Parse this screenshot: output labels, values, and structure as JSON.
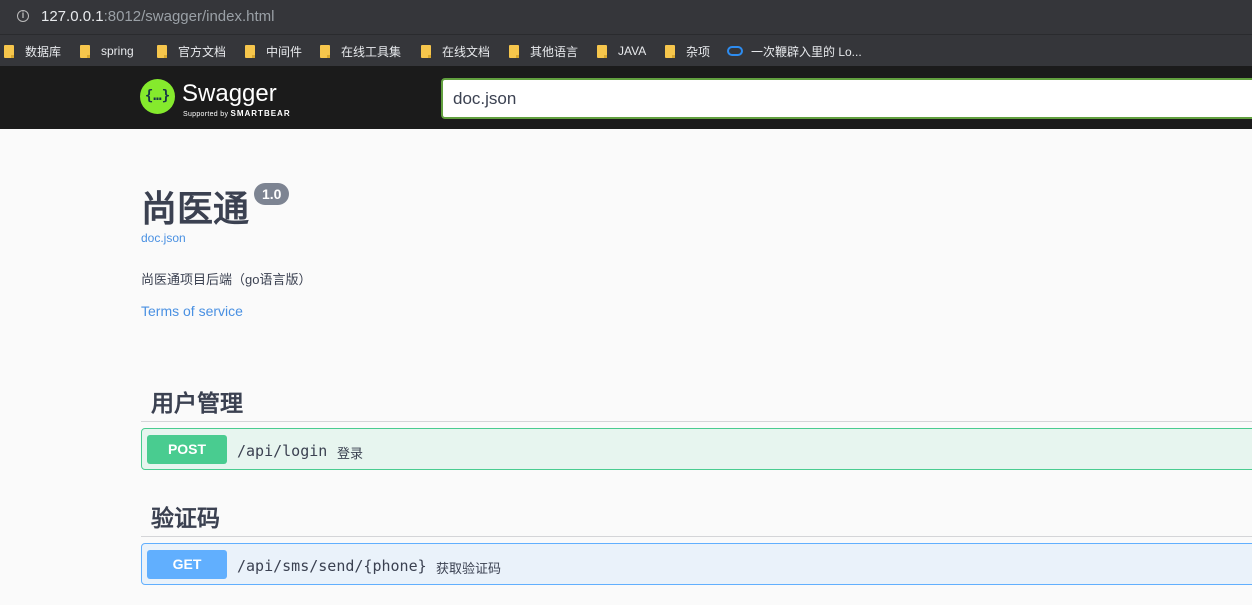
{
  "browser": {
    "url_host": "127.0.0.1",
    "url_rest": ":8012/swagger/index.html",
    "bookmarks": [
      {
        "label": "数据库",
        "icon": "folder-icon"
      },
      {
        "label": "spring",
        "icon": "folder-icon"
      },
      {
        "label": "官方文档",
        "icon": "folder-icon"
      },
      {
        "label": "中间件",
        "icon": "folder-icon"
      },
      {
        "label": "在线工具集",
        "icon": "folder-icon"
      },
      {
        "label": "在线文档",
        "icon": "folder-icon"
      },
      {
        "label": "其他语言",
        "icon": "folder-icon"
      },
      {
        "label": "JAVA",
        "icon": "folder-icon"
      },
      {
        "label": "杂项",
        "icon": "folder-icon"
      },
      {
        "label": "一次鞭辟入里的 Lo...",
        "icon": "cloud-icon"
      }
    ]
  },
  "topbar": {
    "logo_glyph": "{…}",
    "logo_text": "Swagger",
    "logo_sub_prefix": "Supported by",
    "logo_sub_brand": "SMARTBEAR",
    "spec_url": "doc.json"
  },
  "info": {
    "title": "尚医通",
    "version": "1.0",
    "doc_link": "doc.json",
    "description": "尚医通项目后端（go语言版）",
    "terms": "Terms of service"
  },
  "tags": [
    {
      "name": "用户管理",
      "operations": [
        {
          "method": "POST",
          "path": "/api/login",
          "summary": "登录"
        }
      ]
    },
    {
      "name": "验证码",
      "operations": [
        {
          "method": "GET",
          "path": "/api/sms/send/{phone}",
          "summary": "获取验证码"
        }
      ]
    }
  ],
  "colors": {
    "post": "#49cc90",
    "get": "#61affe",
    "link": "#4990e2",
    "topbar_bg": "#1b1b1b",
    "logo_green": "#85ea2d"
  }
}
